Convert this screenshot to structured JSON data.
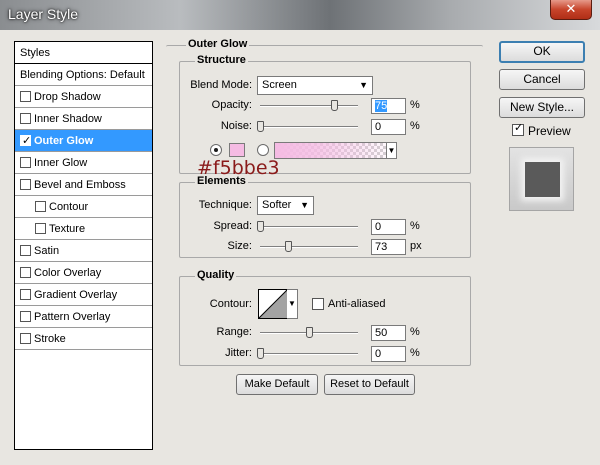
{
  "window": {
    "title": "Layer Style",
    "close": "✕"
  },
  "styles_list": {
    "header": "Styles",
    "blending": "Blending Options: Default",
    "items": [
      {
        "label": "Drop Shadow",
        "checked": false,
        "selected": false,
        "sub": false
      },
      {
        "label": "Inner Shadow",
        "checked": false,
        "selected": false,
        "sub": false
      },
      {
        "label": "Outer Glow",
        "checked": true,
        "selected": true,
        "sub": false
      },
      {
        "label": "Inner Glow",
        "checked": false,
        "selected": false,
        "sub": false
      },
      {
        "label": "Bevel and Emboss",
        "checked": false,
        "selected": false,
        "sub": false
      },
      {
        "label": "Contour",
        "checked": false,
        "selected": false,
        "sub": true
      },
      {
        "label": "Texture",
        "checked": false,
        "selected": false,
        "sub": true
      },
      {
        "label": "Satin",
        "checked": false,
        "selected": false,
        "sub": false
      },
      {
        "label": "Color Overlay",
        "checked": false,
        "selected": false,
        "sub": false
      },
      {
        "label": "Gradient Overlay",
        "checked": false,
        "selected": false,
        "sub": false
      },
      {
        "label": "Pattern Overlay",
        "checked": false,
        "selected": false,
        "sub": false
      },
      {
        "label": "Stroke",
        "checked": false,
        "selected": false,
        "sub": false
      }
    ]
  },
  "outer_glow": {
    "title": "Outer Glow",
    "structure": {
      "title": "Structure",
      "blend_mode_label": "Blend Mode:",
      "blend_mode_value": "Screen",
      "opacity_label": "Opacity:",
      "opacity_value": "75",
      "opacity_unit": "%",
      "opacity_fraction": 0.75,
      "noise_label": "Noise:",
      "noise_value": "0",
      "noise_unit": "%",
      "noise_fraction": 0,
      "glow_color": "#f5bbe3",
      "color_annotation": "#f5bbe3"
    },
    "elements": {
      "title": "Elements",
      "technique_label": "Technique:",
      "technique_value": "Softer",
      "spread_label": "Spread:",
      "spread_value": "0",
      "spread_unit": "%",
      "spread_fraction": 0,
      "size_label": "Size:",
      "size_value": "73",
      "size_unit": "px",
      "size_fraction": 0.29
    },
    "quality": {
      "title": "Quality",
      "contour_label": "Contour:",
      "anti_aliased_label": "Anti-aliased",
      "anti_aliased": false,
      "range_label": "Range:",
      "range_value": "50",
      "range_unit": "%",
      "range_fraction": 0.5,
      "jitter_label": "Jitter:",
      "jitter_value": "0",
      "jitter_unit": "%",
      "jitter_fraction": 0
    },
    "make_default": "Make Default",
    "reset_default": "Reset to Default"
  },
  "buttons": {
    "ok": "OK",
    "cancel": "Cancel",
    "new_style": "New Style..."
  },
  "preview": {
    "label": "Preview",
    "checked": true
  }
}
